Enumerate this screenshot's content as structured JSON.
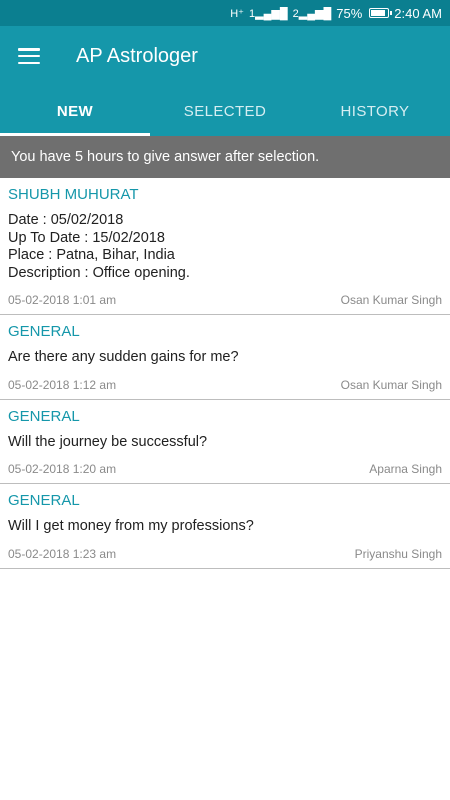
{
  "status_bar": {
    "network": "H⁺",
    "sim1": "1",
    "sim2": "2",
    "battery_percent": "75%",
    "battery_level": 0.75,
    "time": "2:40 AM"
  },
  "app_bar": {
    "title": "AP Astrologer",
    "menu_icon": "hamburger-menu-icon"
  },
  "tabs": [
    {
      "label": "NEW",
      "active": true
    },
    {
      "label": "SELECTED",
      "active": false
    },
    {
      "label": "HISTORY",
      "active": false
    }
  ],
  "notice": "You have 5 hours to give answer after selection.",
  "questions": [
    {
      "category": "SHUBH MUHURAT",
      "lines": [
        "Date : 05/02/2018",
        "Up To Date : 15/02/2018",
        "Place : Patna, Bihar, India",
        "Description : Office opening."
      ],
      "timestamp": "05-02-2018 1:01 am",
      "user": "Osan Kumar Singh"
    },
    {
      "category": "GENERAL",
      "lines": [
        "Are there any sudden gains for me?"
      ],
      "timestamp": "05-02-2018 1:12 am",
      "user": "Osan Kumar Singh"
    },
    {
      "category": "GENERAL",
      "lines": [
        "Will the journey be successful?"
      ],
      "timestamp": "05-02-2018 1:20 am",
      "user": "Aparna Singh"
    },
    {
      "category": "GENERAL",
      "lines": [
        "Will I get money from my professions?"
      ],
      "timestamp": "05-02-2018 1:23 am",
      "user": "Priyanshu Singh"
    }
  ],
  "colors": {
    "status_bar": "#0b7f90",
    "primary": "#1597aa",
    "notice_bg": "#6f6f6f",
    "accent_text": "#1597aa"
  }
}
